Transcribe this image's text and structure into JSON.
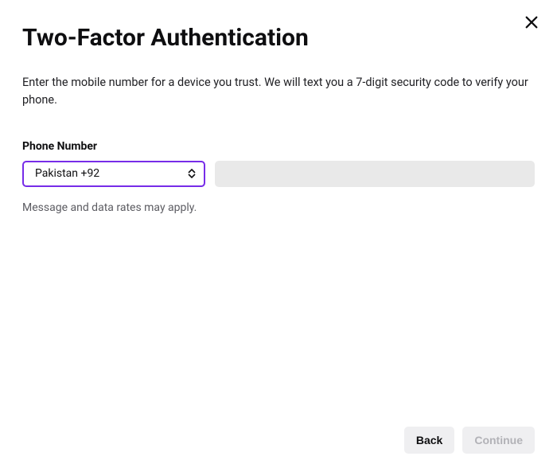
{
  "title": "Two-Factor Authentication",
  "description": "Enter the mobile number for a device you trust. We will text you a 7-digit security code to verify your phone.",
  "phone": {
    "label": "Phone Number",
    "country_selected": "Pakistan +92",
    "input_value": ""
  },
  "helper": "Message and data rates may apply.",
  "buttons": {
    "back": "Back",
    "continue": "Continue"
  }
}
